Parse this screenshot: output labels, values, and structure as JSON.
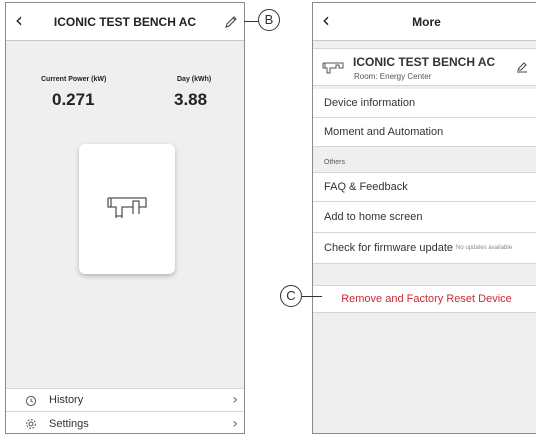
{
  "left_screen": {
    "title": "ICONIC TEST BENCH AC",
    "back_icon": "chevron-left",
    "edit_icon": "pencil",
    "metrics": [
      {
        "label": "Current Power (kW)",
        "value": "0.271"
      },
      {
        "label": "Day (kWh)",
        "value": "3.88"
      }
    ],
    "device_icon": "socket-plug",
    "menu": [
      {
        "label": "History",
        "icon": "history-clock"
      },
      {
        "label": "Settings",
        "icon": "gear"
      }
    ]
  },
  "right_screen": {
    "title": "More",
    "back_icon": "chevron-left",
    "device": {
      "name": "ICONIC TEST BENCH AC",
      "room": "Room: Energy Center",
      "icon": "socket-plug",
      "edit_icon": "pencil"
    },
    "items": [
      {
        "label": "Device information"
      },
      {
        "label": "Moment and Automation"
      }
    ],
    "others_title": "Others",
    "others": [
      {
        "label": "FAQ & Feedback"
      },
      {
        "label": "Add to home screen"
      },
      {
        "label": "Check for firmware update",
        "note": "No updates available"
      }
    ],
    "remove_label": "Remove and Factory Reset Device",
    "remove_color": "#cc2a36"
  },
  "callouts": {
    "edit": "B",
    "remove": "C"
  }
}
